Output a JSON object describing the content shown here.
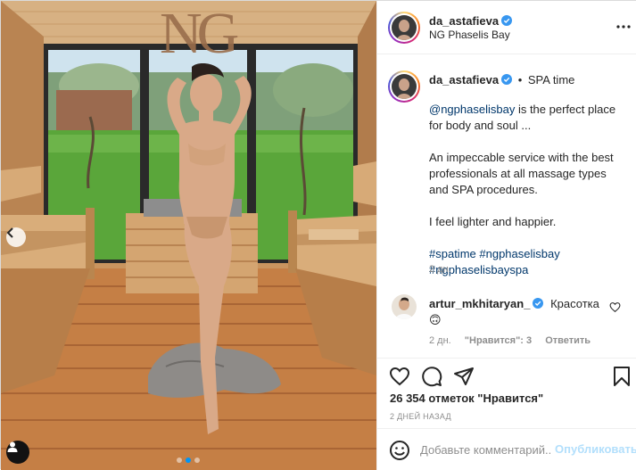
{
  "post": {
    "author": "da_astafieva",
    "location": "NG Phaselis Bay",
    "photo_logo": "NG"
  },
  "caption": {
    "author": "da_astafieva",
    "separator": "•",
    "headline": "SPA time",
    "mention": "@ngphaselisbay",
    "line1_rest": " is the perfect place for body and soul ...",
    "paragraph2": "An impeccable service with the best professionals at all massage types and SPA procedures.",
    "paragraph3": "I feel lighter and happier.",
    "hashtags": [
      "#spatime",
      "#ngphaselisbay",
      "#ngphaselisbayspa"
    ],
    "time": "2 дн."
  },
  "comment": {
    "author": "artur_mkhitaryan_",
    "text": "Красотка",
    "emoji": "🙃",
    "time": "2 дн.",
    "likes_label": "\"Нравится\": 3",
    "reply_label": "Ответить"
  },
  "likes_text": "26 354 отметок \"Нравится\"",
  "date_text": "2 ДНЕЙ НАЗАД",
  "comment_input": {
    "placeholder": "Добавьте комментарий...",
    "post_label": "Опубликовать"
  },
  "icons": {
    "carousel": "chevron-left-icon",
    "user_tag": "user-tag-icon",
    "more": "more-options-icon",
    "like": "heart-icon",
    "comment": "comment-icon",
    "share": "paper-plane-icon",
    "save": "bookmark-icon",
    "emoji": "smiley-icon",
    "verified": "verified-badge-icon"
  },
  "colors": {
    "link": "#00376b",
    "verified": "#3897f0",
    "post_button_disabled": "#b2dffc",
    "carousel_active": "#0095f6"
  },
  "carousel": {
    "slides": 3,
    "active": 1
  }
}
